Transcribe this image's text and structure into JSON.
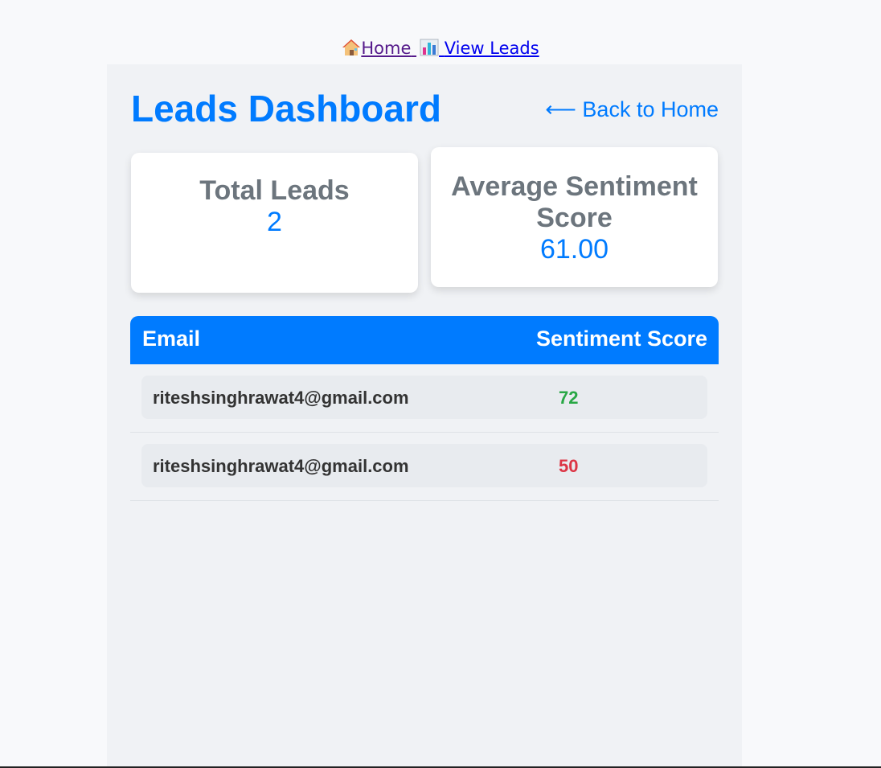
{
  "nav": {
    "home_label": "Home",
    "leads_label": "View Leads",
    "home_icon": "house-icon",
    "leads_icon": "bar-chart-icon"
  },
  "header": {
    "title": "Leads Dashboard",
    "back_label": "⟵ Back to Home",
    "back_icon": "left-arrow-icon"
  },
  "cards": {
    "total": {
      "label": "Total Leads",
      "value": "2"
    },
    "average": {
      "label": "Average Sentiment Score",
      "value": "61.00"
    }
  },
  "table": {
    "headers": {
      "email": "Email",
      "score": "Sentiment Score"
    },
    "rows": [
      {
        "email": "riteshsinghrawat4@gmail.com",
        "score": "72",
        "color": "#28a745"
      },
      {
        "email": "riteshsinghrawat4@gmail.com",
        "score": "50",
        "color": "#dc3545"
      }
    ]
  },
  "colors": {
    "accent": "#007bff",
    "positive": "#28a745",
    "negative": "#dc3545",
    "muted": "#6c757d"
  }
}
